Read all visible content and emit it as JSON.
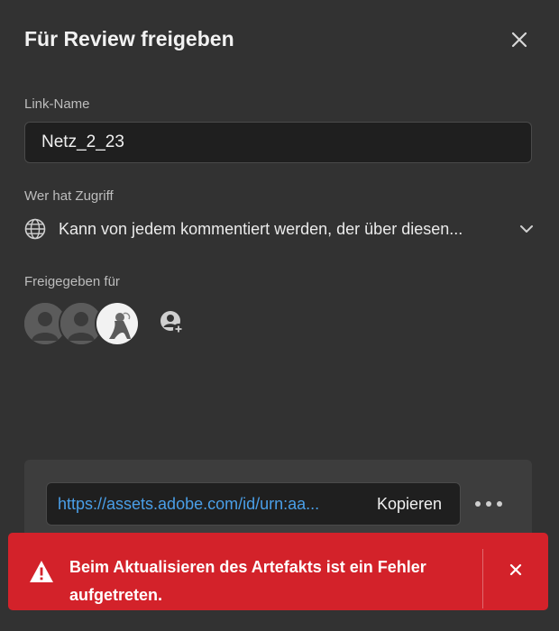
{
  "dialog": {
    "title": "Für Review freigeben"
  },
  "link_name": {
    "label": "Link-Name",
    "value": "Netz_2_23"
  },
  "access": {
    "label": "Wer hat Zugriff",
    "value": "Kann von jedem kommentiert werden, der über diesen...",
    "icon": "globe-icon"
  },
  "shared": {
    "label": "Freigegeben für",
    "avatars": [
      "user-placeholder",
      "user-placeholder",
      "user-photo"
    ],
    "add_icon": "add-user-icon"
  },
  "share_link": {
    "url": "https://assets.adobe.com/id/urn:aa...",
    "copy_label": "Kopieren"
  },
  "toast": {
    "message": "Beim Aktualisieren des Artefakts ist ein Fehler aufgetreten.",
    "color": "#d3222a"
  },
  "colors": {
    "background": "#323232",
    "link": "#4a9fe8"
  }
}
